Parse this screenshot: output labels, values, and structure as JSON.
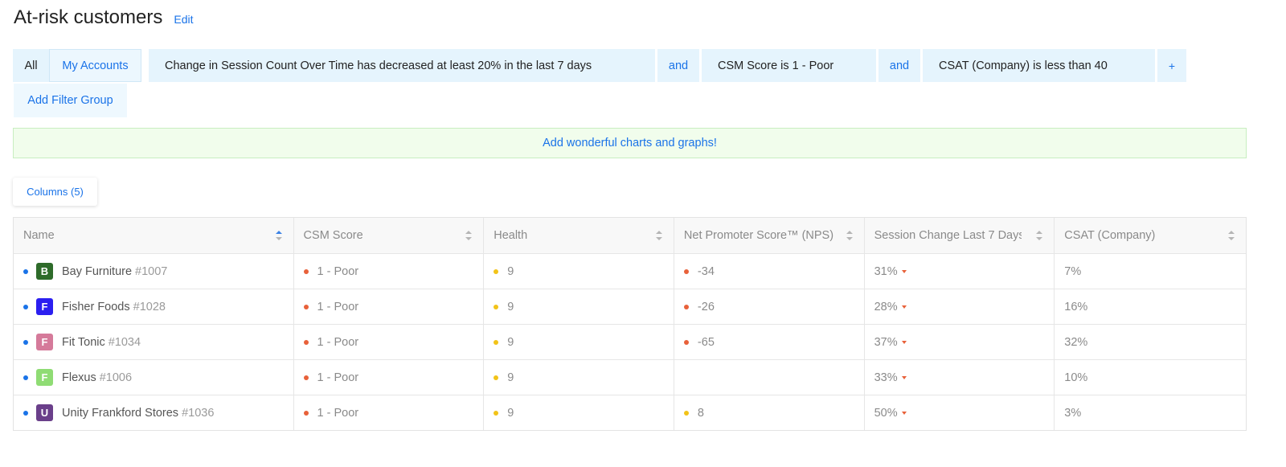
{
  "header": {
    "title": "At-risk customers",
    "edit": "Edit"
  },
  "filters": {
    "all": "All",
    "my_accounts": "My Accounts",
    "rules": [
      "Change in Session Count Over Time has decreased at least 20% in the last 7 days",
      "CSM Score is 1 - Poor",
      "CSAT (Company) is less than 40"
    ],
    "connector": "and",
    "plus": "+",
    "add_group": "Add Filter Group"
  },
  "banner": "Add wonderful charts and graphs!",
  "columns_button": "Columns (5)",
  "table": {
    "headers": [
      "Name",
      "CSM Score",
      "Health",
      "Net Promoter Score™ (NPS)",
      "Session Change Last 7 Days",
      "CSAT (Company)"
    ],
    "rows": [
      {
        "initial": "B",
        "avatar_color": "#2e6b2a",
        "name": "Bay Furniture",
        "id": "#1007",
        "csm": "1 - Poor",
        "health": "9",
        "nps": "-34",
        "nps_color": "#e8613a",
        "session": "31%",
        "csat": "7%"
      },
      {
        "initial": "F",
        "avatar_color": "#2b1ff0",
        "name": "Fisher Foods",
        "id": "#1028",
        "csm": "1 - Poor",
        "health": "9",
        "nps": "-26",
        "nps_color": "#e8613a",
        "session": "28%",
        "csat": "16%"
      },
      {
        "initial": "F",
        "avatar_color": "#d57a9a",
        "name": "Fit Tonic",
        "id": "#1034",
        "csm": "1 - Poor",
        "health": "9",
        "nps": "-65",
        "nps_color": "#e8613a",
        "session": "37%",
        "csat": "32%"
      },
      {
        "initial": "F",
        "avatar_color": "#8fdc74",
        "name": "Flexus",
        "id": "#1006",
        "csm": "1 - Poor",
        "health": "9",
        "nps": "",
        "nps_color": "",
        "session": "33%",
        "csat": "10%"
      },
      {
        "initial": "U",
        "avatar_color": "#6a3f8a",
        "name": "Unity Frankford Stores",
        "id": "#1036",
        "csm": "1 - Poor",
        "health": "9",
        "nps": "8",
        "nps_color": "#f2c318",
        "session": "50%",
        "csat": "3%"
      }
    ]
  },
  "colors": {
    "accent": "#1a73e8",
    "poor": "#e8613a",
    "health": "#f2c318",
    "banner_bg": "#f1fdec",
    "filter_bg": "#e5f4fd"
  }
}
